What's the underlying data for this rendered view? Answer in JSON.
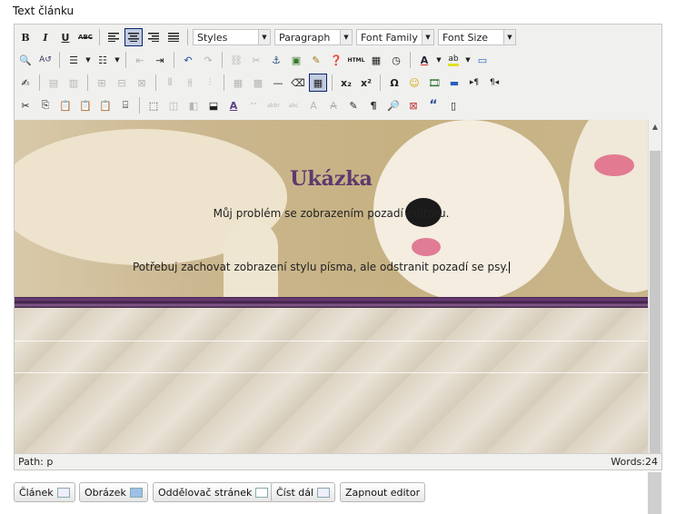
{
  "field_label": "Text článku",
  "toolbar": {
    "row1": {
      "bold": "B",
      "italic": "I",
      "underline": "U",
      "strike": "ABC",
      "styles": "Styles",
      "format": "Paragraph",
      "font_family": "Font Family",
      "font_size": "Font Size"
    },
    "row2": {
      "html": "HTML"
    },
    "row3": {
      "sub": "x₂",
      "sup": "x²",
      "omega": "Ω",
      "pilcrow_ltr": "▸¶",
      "pilcrow_rtl": "¶◂"
    },
    "row4": {
      "ins": "A",
      "pilcrow": "¶",
      "quote": "“"
    }
  },
  "content": {
    "heading": "Ukázka",
    "paragraph1": "Můj problém se zobrazením pozadí editoru.",
    "paragraph2": "Potřebuj zachovat zobrazení stylu písma, ale odstranit pozadí se psy."
  },
  "status": {
    "path": "Path: p",
    "words": "Words:24"
  },
  "buttons": {
    "article": "Článek",
    "image": "Obrázek",
    "page_break": "Oddělovač stránek",
    "read_more": "Číst dál",
    "toggle_editor": "Zapnout editor"
  },
  "colors": {
    "heading": "#5b3a6e",
    "stripe": "#4b2a55",
    "active_btn": "#c2cbe0"
  }
}
